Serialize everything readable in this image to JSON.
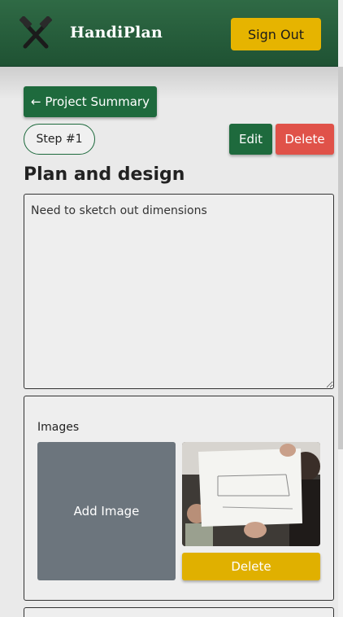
{
  "header": {
    "brand": "HandiPlan",
    "logo_icon": "crossed-hammers-icon",
    "sign_out_label": "Sign Out",
    "colors": {
      "bar": "#1f5233",
      "accent": "#e6b400"
    }
  },
  "nav": {
    "back_label": "← Project Summary"
  },
  "step": {
    "badge": "Step #1",
    "edit_label": "Edit",
    "delete_label": "Delete",
    "title": "Plan and design",
    "notes": "Need to sketch out dimensions"
  },
  "images": {
    "heading": "Images",
    "add_label": "Add Image",
    "delete_label": "Delete"
  },
  "colors": {
    "primary_green": "#1e6a3d",
    "danger_red": "#e05249",
    "warning_yellow": "#e0b000",
    "secondary_gray": "#6c757d"
  }
}
